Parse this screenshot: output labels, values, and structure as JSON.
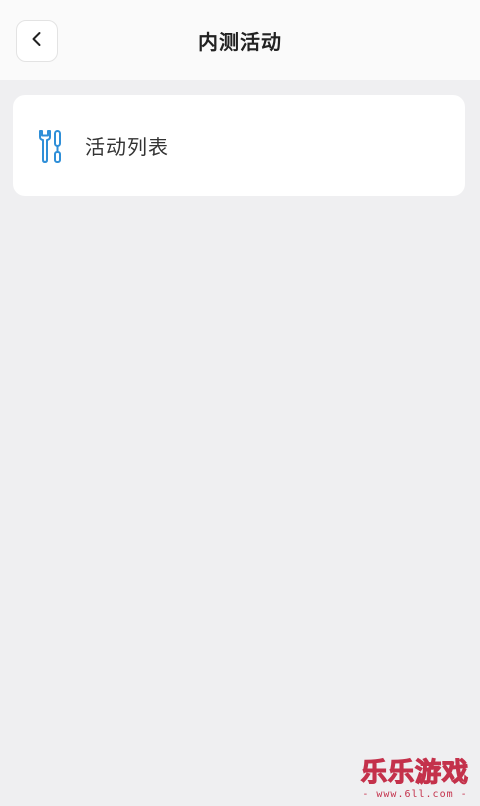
{
  "header": {
    "title": "内测活动",
    "back_icon": "chevron-left-icon"
  },
  "menu": {
    "items": [
      {
        "label": "活动列表",
        "icon": "tools-icon",
        "icon_color": "#2f8fd8"
      }
    ]
  },
  "watermark": {
    "title": "乐乐游戏",
    "subtitle": "- www.6ll.com -",
    "color": "#c4314b"
  },
  "colors": {
    "background": "#efeff1",
    "header_bg": "#fafafa",
    "card_bg": "#ffffff",
    "icon_blue": "#2f8fd8"
  }
}
